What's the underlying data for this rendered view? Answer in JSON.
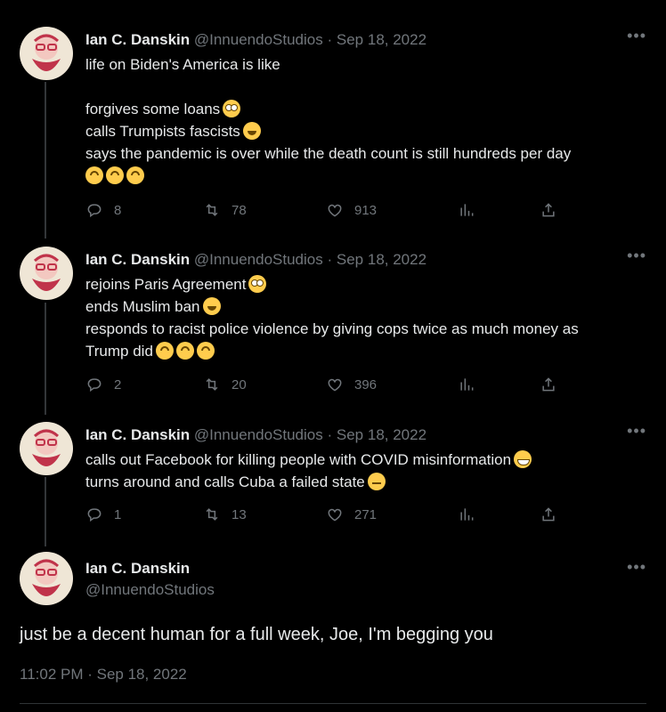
{
  "author": {
    "name": "Ian C. Danskin",
    "handle": "@InnuendoStudios"
  },
  "separator": "·",
  "more_label": "•••",
  "tweets": [
    {
      "date": "Sep 18, 2022",
      "lines": [
        {
          "text": "life on Biden's America is like",
          "emoji": []
        },
        {
          "text": "",
          "emoji": []
        },
        {
          "text": "forgives some loans",
          "emoji": [
            "flushed-face"
          ]
        },
        {
          "text": "calls Trumpists fascists",
          "emoji": [
            "grinning-face"
          ]
        },
        {
          "text": "says the pandemic is over while the death count is still hundreds per day",
          "emoji": []
        },
        {
          "text": "",
          "emoji": [
            "upside-down-face",
            "upside-down-face",
            "upside-down-face"
          ]
        }
      ],
      "replies": "8",
      "retweets": "78",
      "likes": "913"
    },
    {
      "date": "Sep 18, 2022",
      "lines": [
        {
          "text": "rejoins Paris Agreement",
          "emoji": [
            "flushed-face"
          ]
        },
        {
          "text": "ends Muslim ban",
          "emoji": [
            "grinning-face"
          ]
        },
        {
          "text": "responds to racist police violence by giving cops twice as much money as",
          "emoji": []
        },
        {
          "text": "Trump did",
          "emoji": [
            "upside-down-face",
            "upside-down-face",
            "upside-down-face"
          ]
        }
      ],
      "replies": "2",
      "retweets": "20",
      "likes": "396"
    },
    {
      "date": "Sep 18, 2022",
      "lines": [
        {
          "text": "calls out Facebook for killing people with COVID misinformation",
          "emoji": [
            "beaming-face"
          ]
        },
        {
          "text": "turns around and calls Cuba a failed state",
          "emoji": [
            "confounded-face"
          ]
        }
      ],
      "replies": "1",
      "retweets": "13",
      "likes": "271"
    }
  ],
  "main_tweet": {
    "text": "just be a decent human for a full week, Joe, I'm begging you",
    "timestamp": "11:02 PM · Sep 18, 2022"
  },
  "icons": [
    "reply-icon",
    "retweet-icon",
    "like-icon",
    "views-icon",
    "share-icon"
  ],
  "colors": {
    "background": "#000000",
    "text": "#e7e9ea",
    "secondary": "#71767b",
    "emoji": "#ffcc4d"
  }
}
